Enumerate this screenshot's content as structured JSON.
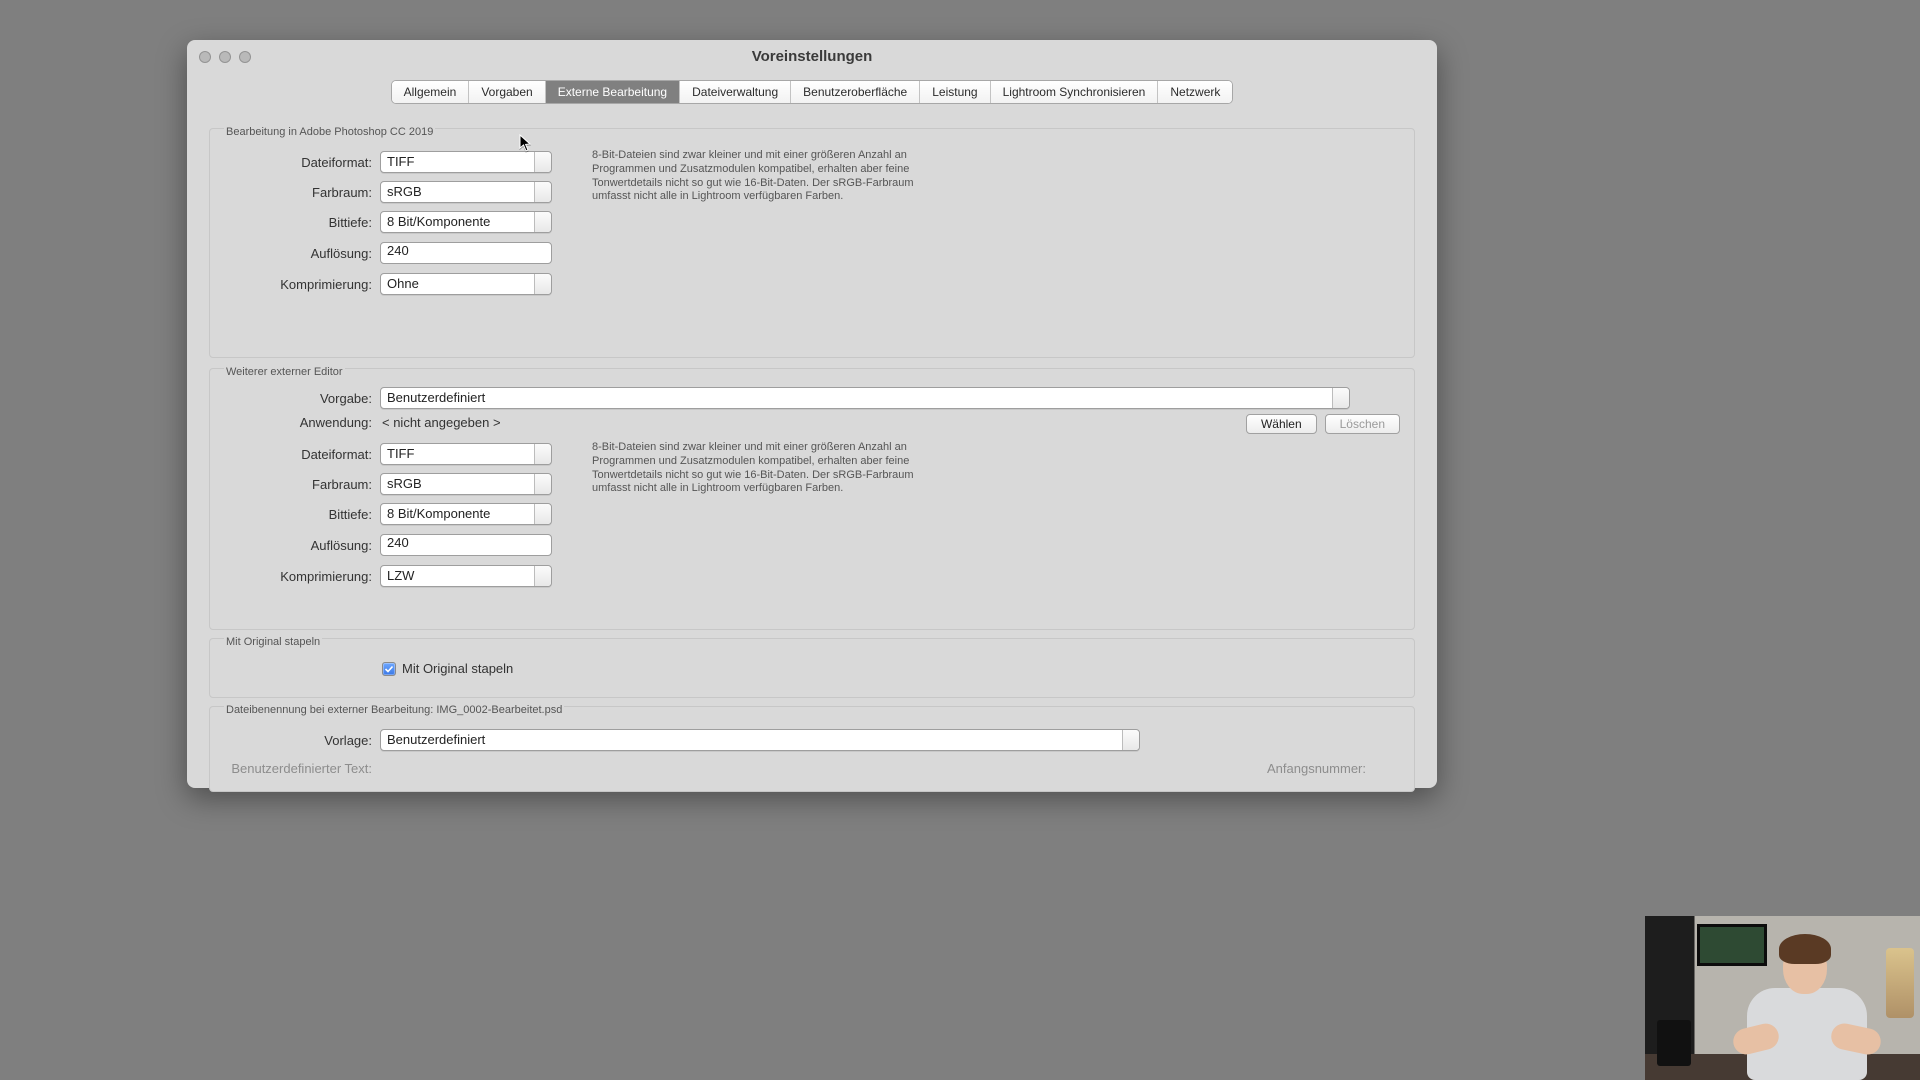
{
  "window": {
    "title": "Voreinstellungen"
  },
  "tabs": [
    "Allgemein",
    "Vorgaben",
    "Externe Bearbeitung",
    "Dateiverwaltung",
    "Benutzeroberfläche",
    "Leistung",
    "Lightroom Synchronisieren",
    "Netzwerk"
  ],
  "active_tab_index": 2,
  "section1": {
    "title": "Bearbeitung in Adobe Photoshop CC 2019",
    "file_format_label": "Dateiformat:",
    "file_format": "TIFF",
    "color_space_label": "Farbraum:",
    "color_space": "sRGB",
    "bit_depth_label": "Bittiefe:",
    "bit_depth": "8 Bit/Komponente",
    "resolution_label": "Auflösung:",
    "resolution": "240",
    "compression_label": "Komprimierung:",
    "compression": "Ohne",
    "hint": "8-Bit-Dateien sind zwar kleiner und mit einer größeren Anzahl an Programmen und Zusatzmodulen kompatibel, erhalten aber feine Tonwertdetails nicht so gut wie 16-Bit-Daten. Der sRGB-Farbraum umfasst nicht alle in Lightroom verfügbaren Farben."
  },
  "section2": {
    "title": "Weiterer externer Editor",
    "preset_label": "Vorgabe:",
    "preset": "Benutzerdefiniert",
    "app_label": "Anwendung:",
    "app_value": "< nicht angegeben >",
    "choose_btn": "Wählen",
    "clear_btn": "Löschen",
    "file_format_label": "Dateiformat:",
    "file_format": "TIFF",
    "color_space_label": "Farbraum:",
    "color_space": "sRGB",
    "bit_depth_label": "Bittiefe:",
    "bit_depth": "8 Bit/Komponente",
    "resolution_label": "Auflösung:",
    "resolution": "240",
    "compression_label": "Komprimierung:",
    "compression": "LZW",
    "hint": "8-Bit-Dateien sind zwar kleiner und mit einer größeren Anzahl an Programmen und Zusatzmodulen kompatibel, erhalten aber feine Tonwertdetails nicht so gut wie 16-Bit-Daten. Der sRGB-Farbraum umfasst nicht alle in Lightroom verfügbaren Farben."
  },
  "section3": {
    "title": "Mit Original stapeln",
    "checkbox_label": "Mit Original stapeln",
    "checked": true
  },
  "section4": {
    "title": "Dateibenennung bei externer Bearbeitung: IMG_0002-Bearbeitet.psd",
    "template_label": "Vorlage:",
    "template": "Benutzerdefiniert",
    "custom_text_label": "Benutzerdefinierter Text:",
    "start_number_label": "Anfangsnummer:"
  }
}
